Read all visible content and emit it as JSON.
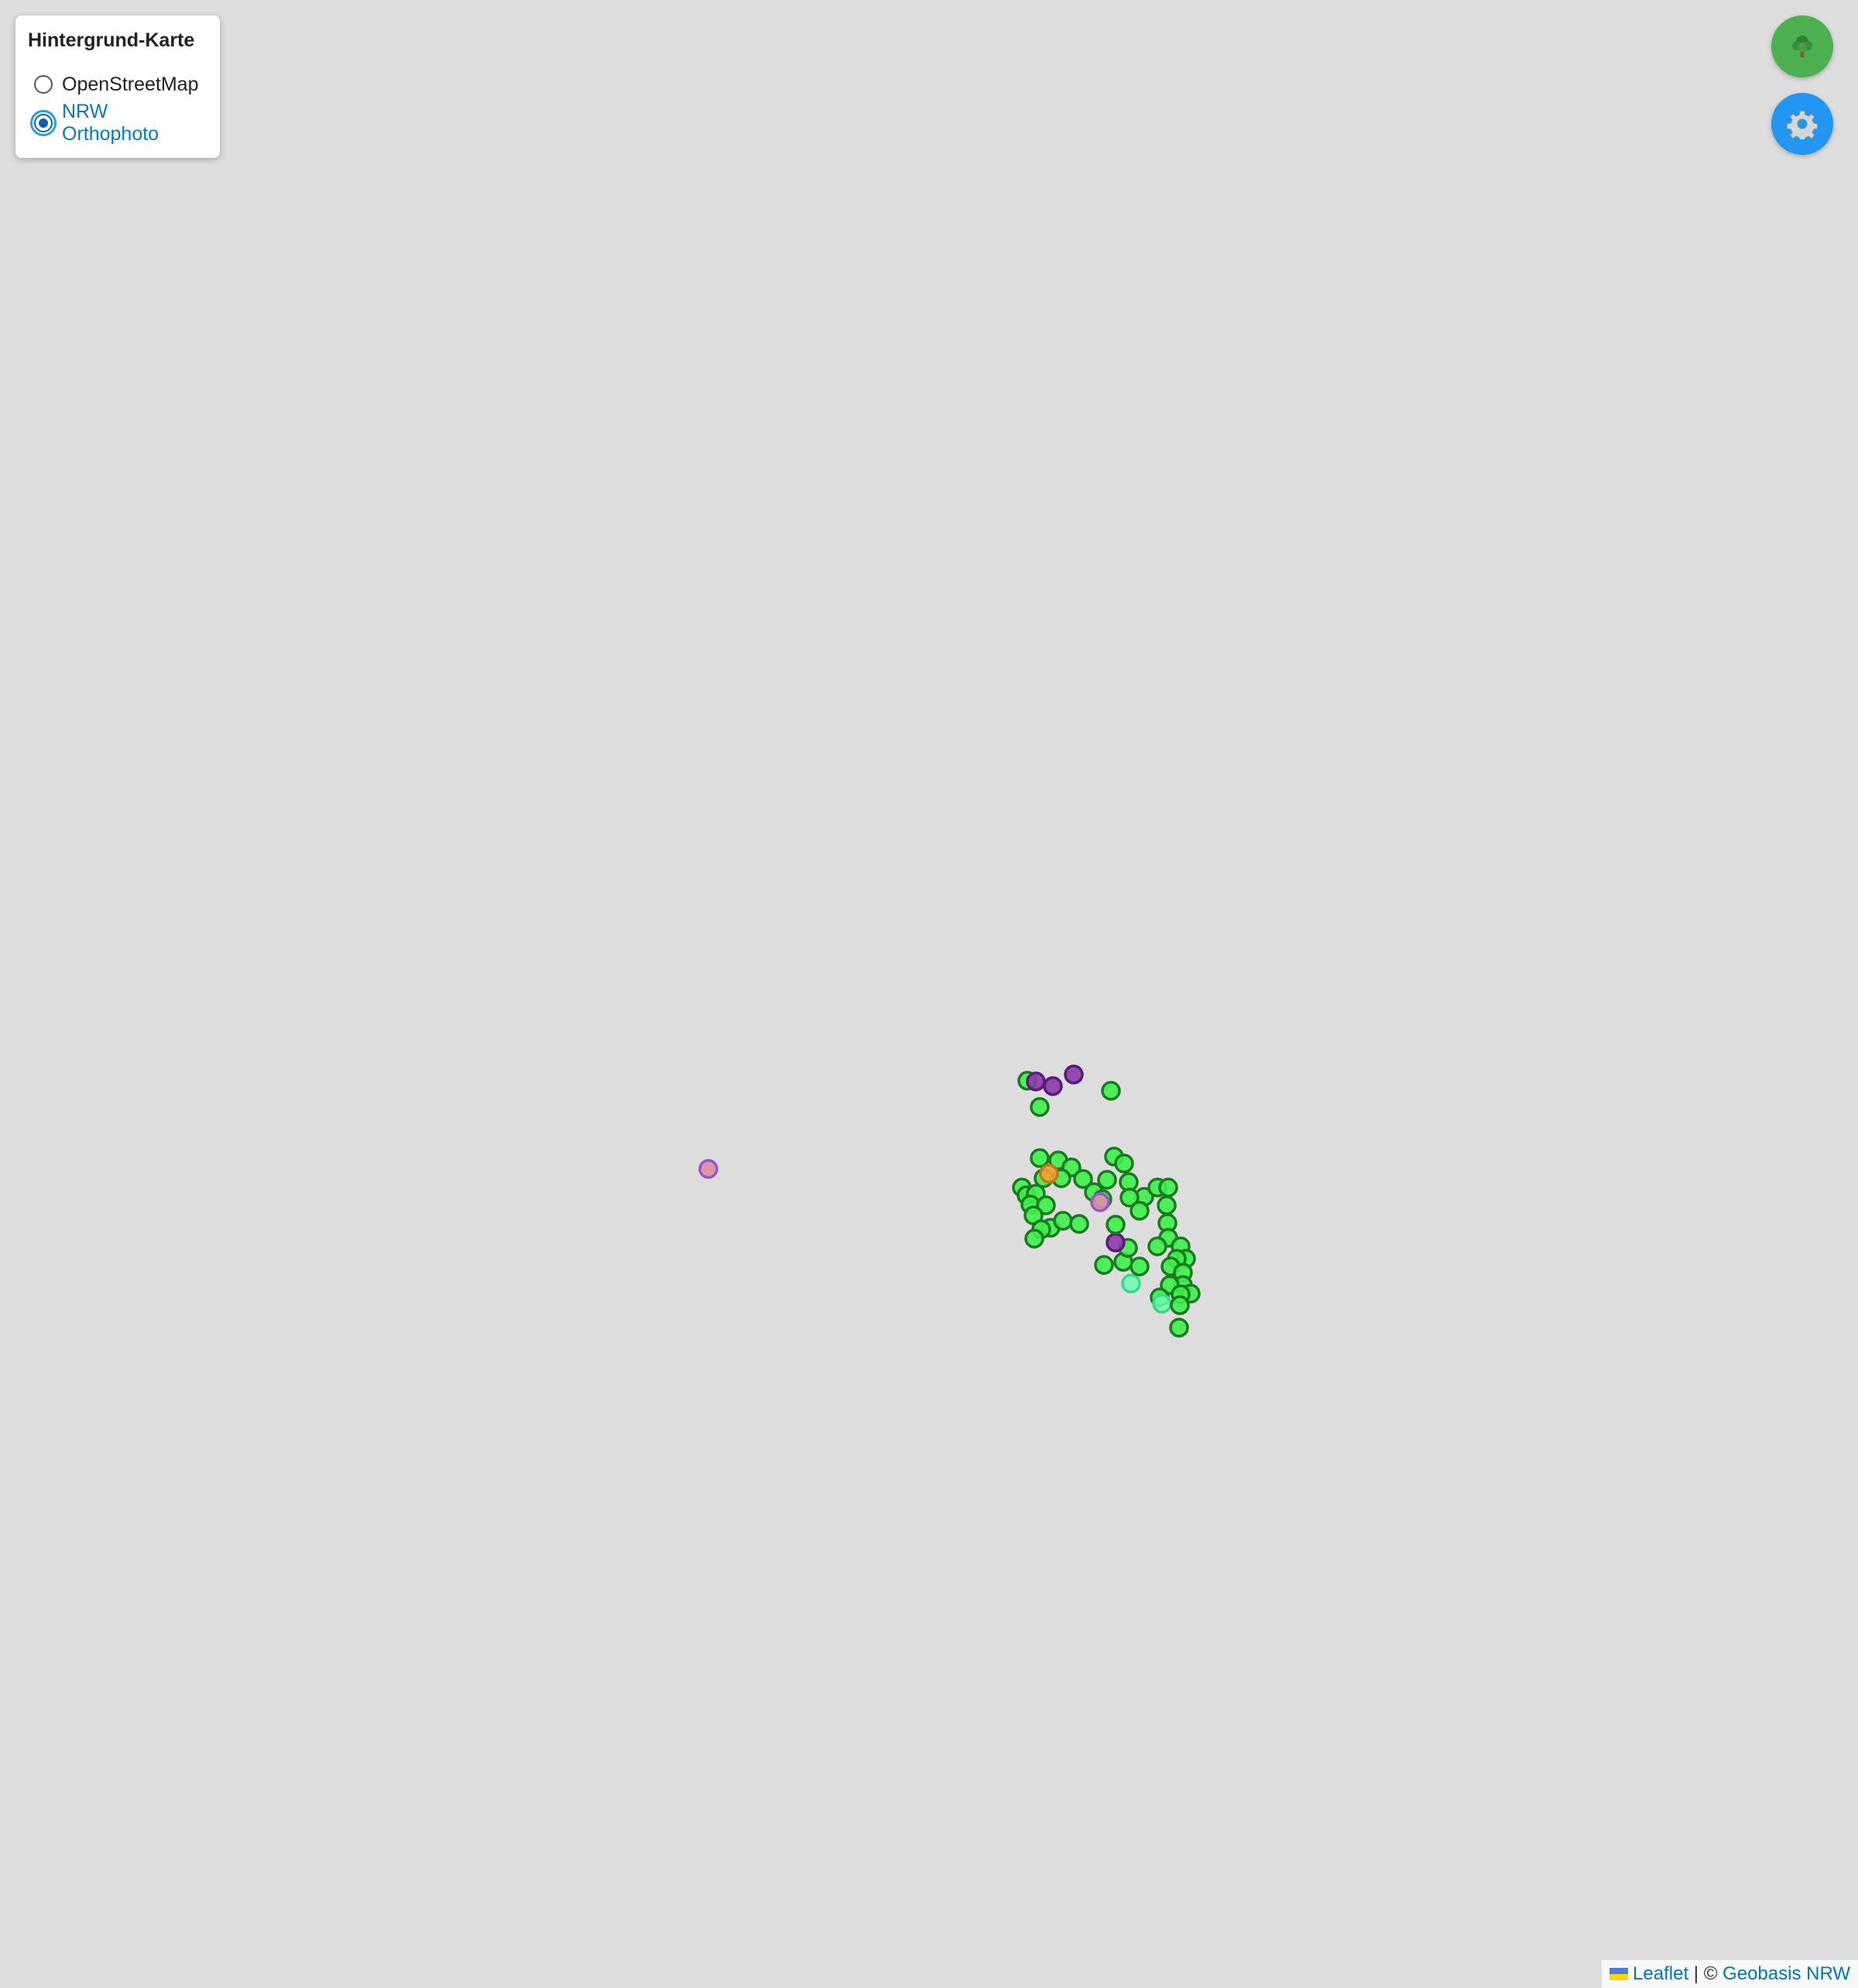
{
  "layer_control": {
    "title": "Hintergrund-Karte",
    "options": [
      {
        "label": "OpenStreetMap",
        "selected": false
      },
      {
        "label": "NRW Orthophoto",
        "selected": true
      }
    ]
  },
  "buttons": {
    "tree_icon": "tree-icon",
    "settings_icon": "gear-icon"
  },
  "attribution": {
    "leaflet_label": "Leaflet",
    "separator": "|",
    "copyright": "©",
    "source_label": "Geobasis NRW"
  },
  "colors": {
    "map_background": "#dddddd",
    "tree_green": "#3df04a",
    "tree_purple": "#8a3aa8",
    "tree_pink": "#d98fa6",
    "tree_mint": "#6dfcb0",
    "tree_orange": "#f0a030",
    "tree_button": "#4caf50",
    "settings_button": "#2196f3"
  }
}
